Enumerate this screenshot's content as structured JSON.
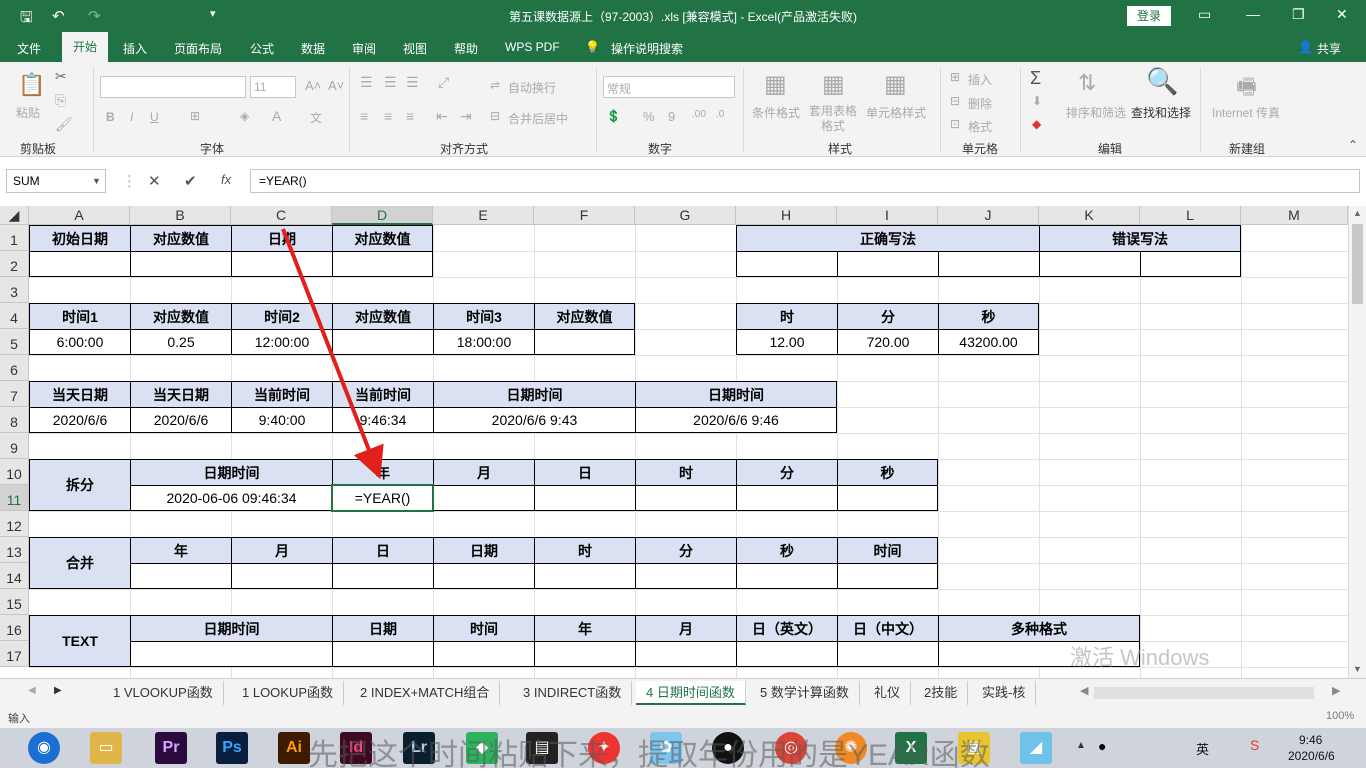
{
  "titlebar": {
    "title": "第五课数据源上（97-2003）.xls  [兼容模式]  -  Excel(产品激活失败)",
    "login": "登录"
  },
  "tabs": [
    {
      "label": "文件"
    },
    {
      "label": "开始"
    },
    {
      "label": "插入"
    },
    {
      "label": "页面布局"
    },
    {
      "label": "公式"
    },
    {
      "label": "数据"
    },
    {
      "label": "审阅"
    },
    {
      "label": "视图"
    },
    {
      "label": "帮助"
    },
    {
      "label": "WPS PDF"
    },
    {
      "label": "操作说明搜索"
    }
  ],
  "share": "共享",
  "ribbon": {
    "groups": [
      "剪贴板",
      "字体",
      "对齐方式",
      "数字",
      "样式",
      "单元格",
      "编辑",
      "新建组"
    ],
    "paste": "粘贴",
    "font_size": "11",
    "wrap": "自动换行",
    "merge": "合并后居中",
    "numfmt": "常规",
    "cond": "条件格式",
    "table": "套用表格格式",
    "cellstyle": "单元格样式",
    "insert": "插入",
    "delete": "删除",
    "format": "格式",
    "sortfilter": "排序和筛选",
    "findselect": "查找和选择",
    "internet": "Internet 传真"
  },
  "formula": {
    "namebox": "SUM",
    "content": "=YEAR()"
  },
  "columns": [
    "A",
    "B",
    "C",
    "D",
    "E",
    "F",
    "G",
    "H",
    "I",
    "J",
    "K",
    "L",
    "M"
  ],
  "rows": [
    "1",
    "2",
    "3",
    "4",
    "5",
    "6",
    "7",
    "8",
    "9",
    "10",
    "11",
    "12",
    "13",
    "14",
    "15",
    "16",
    "17"
  ],
  "cells": {
    "r1": [
      "初始日期",
      "对应数值",
      "日期",
      "对应数值"
    ],
    "r1right": [
      "正确写法",
      "错误写法"
    ],
    "r4": [
      "时间1",
      "对应数值",
      "时间2",
      "对应数值",
      "时间3",
      "对应数值"
    ],
    "r4right": [
      "时",
      "分",
      "秒"
    ],
    "r5": [
      "6:00:00",
      "0.25",
      "12:00:00",
      "18:00:00"
    ],
    "r5right": [
      "12.00",
      "720.00",
      "43200.00"
    ],
    "r7": [
      "当天日期",
      "当天日期",
      "当前时间",
      "当前时间",
      "日期时间",
      "日期时间"
    ],
    "r8": [
      "2020/6/6",
      "2020/6/6",
      "9:40:00",
      "9:46:34",
      "2020/6/6 9:43",
      "2020/6/6 9:46"
    ],
    "split": "拆分",
    "r10": [
      "日期时间",
      "年",
      "月",
      "日",
      "时",
      "分",
      "秒"
    ],
    "r11": [
      "2020-06-06 09:46:34",
      "=YEAR()"
    ],
    "merge": "合并",
    "r13": [
      "年",
      "月",
      "日",
      "日期",
      "时",
      "分",
      "秒",
      "时间"
    ],
    "text": "TEXT",
    "r16": [
      "日期时间",
      "日期",
      "时间",
      "年",
      "月",
      "日（英文）",
      "日（中文）",
      "多种格式"
    ]
  },
  "sheet_tabs": [
    "1 VLOOKUP函数",
    "1 LOOKUP函数",
    "2 INDEX+MATCH组合",
    "3 INDIRECT函数",
    "4 日期时间函数",
    "5 数学计算函数",
    "礼仪",
    "2技能",
    "实践-核"
  ],
  "status": {
    "mode": "输入",
    "zoom": "100%"
  },
  "taskbar": {
    "caption": "先把这个时间粘贴下来，提取年份用的是YEAR函数",
    "time": "9:46",
    "date": "2020/6/6",
    "ime": "英"
  },
  "watermark": "激活 Windows"
}
